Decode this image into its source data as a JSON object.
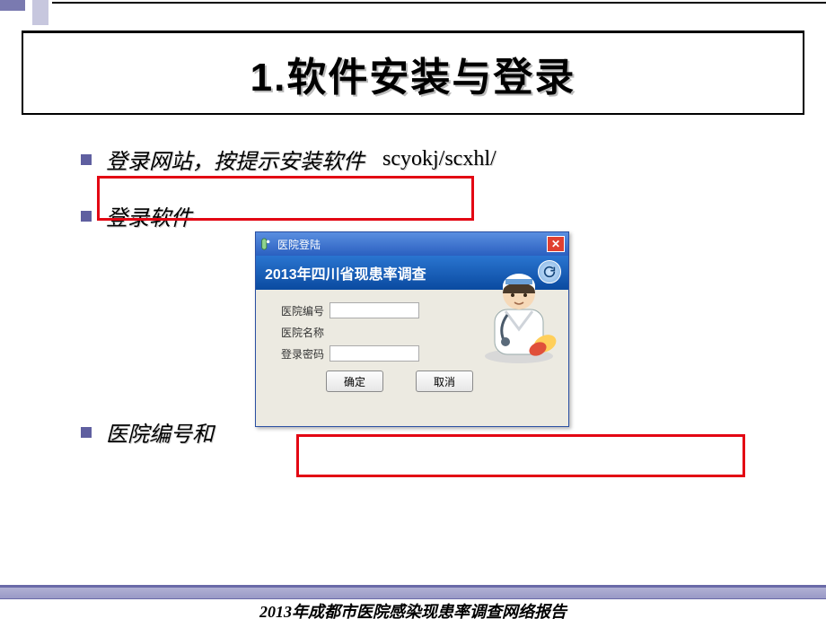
{
  "header": {
    "title": "1.软件安装与登录"
  },
  "bullets": [
    {
      "text": "登录网站，按提示安装软件",
      "extra": "scyokj/scxhl/"
    },
    {
      "text": "登录软件",
      "extra": ""
    },
    {
      "text": "医院编号和",
      "extra": ""
    }
  ],
  "dialog": {
    "titlebar": "医院登陆",
    "close_icon": "close-icon",
    "banner": "2013年四川省现患率调查",
    "refresh_icon": "refresh-icon",
    "fields": {
      "hospital_id_label": "医院编号",
      "hospital_id_value": "",
      "hospital_name_label": "医院名称",
      "hospital_name_value": "",
      "password_label": "登录密码",
      "password_value": ""
    },
    "buttons": {
      "ok": "确定",
      "cancel": "取消"
    }
  },
  "footer": {
    "text": "2013年成都市医院感染现患率调查网络报告"
  }
}
